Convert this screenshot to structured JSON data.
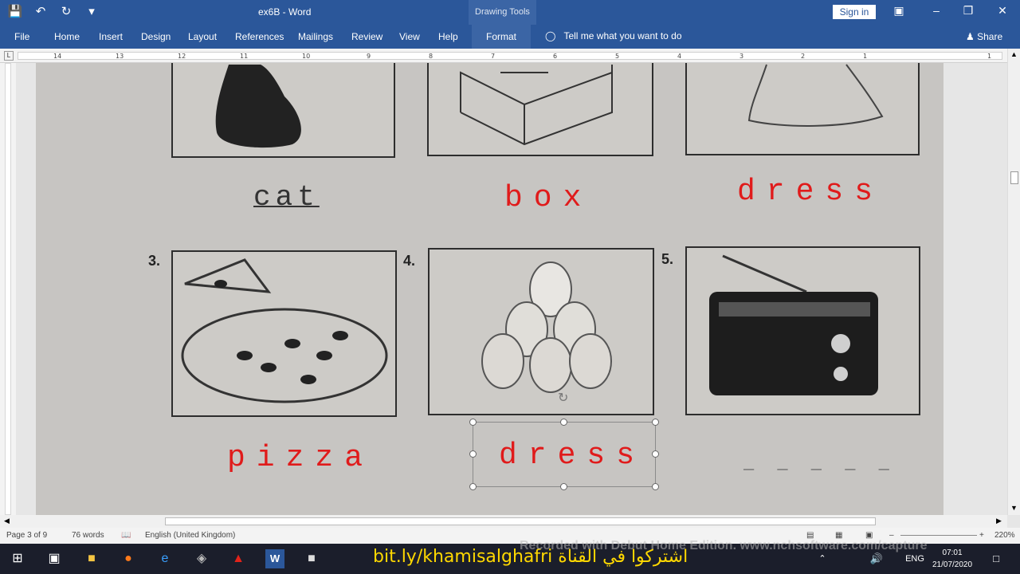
{
  "titlebar": {
    "title": "ex6B  -  Word",
    "context_tools": "Drawing Tools",
    "signin": "Sign in"
  },
  "ribbon": {
    "tabs": [
      "File",
      "Home",
      "Insert",
      "Design",
      "Layout",
      "References",
      "Mailings",
      "Review",
      "View",
      "Help"
    ],
    "format_tab": "Format",
    "tellme": "Tell me what you want to do",
    "share": "Share"
  },
  "ruler": {
    "labels": [
      "14",
      "13",
      "12",
      "11",
      "10",
      "9",
      "8",
      "7",
      "6",
      "5",
      "4",
      "3",
      "2",
      "1",
      "1"
    ]
  },
  "worksheet": {
    "items": [
      {
        "number": "",
        "word": "cat",
        "style": "black"
      },
      {
        "number": "",
        "word": "box",
        "style": "red"
      },
      {
        "number": "",
        "word": "dress",
        "style": "red"
      },
      {
        "number": "3.",
        "word": "pizza",
        "style": "red"
      },
      {
        "number": "4.",
        "word": "dress",
        "style": "red"
      },
      {
        "number": "5.",
        "word": "",
        "blanks": "_ _ _ _ _"
      }
    ]
  },
  "status": {
    "page": "Page 3 of 9",
    "words": "76 words",
    "language": "English (United Kingdom)",
    "zoom": "220%"
  },
  "taskbar": {
    "promo": "bit.ly/khamisalghafri اشتركوا في القناة",
    "watermark": "Recorded with Debut Home Edition. www.nchsoftware.com/capture",
    "lang": "ENG",
    "time": "07:01",
    "date": "21/07/2020"
  }
}
